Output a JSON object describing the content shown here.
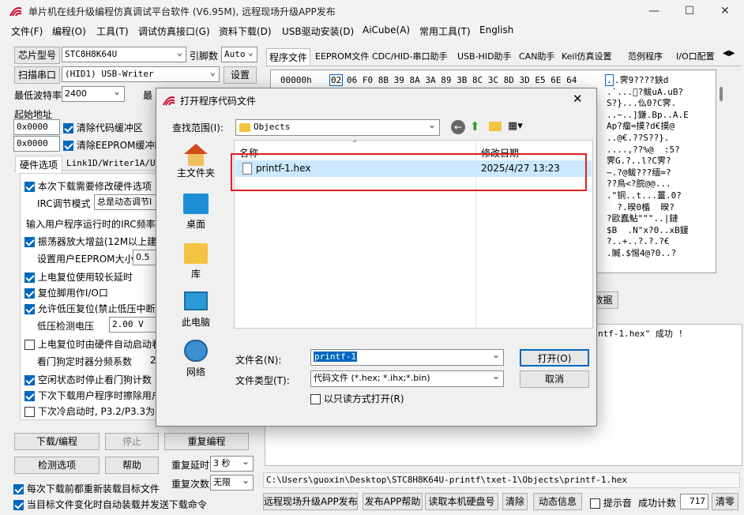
{
  "window": {
    "title": "单片机在线升级编程仿真调试平台软件 (V6.95M), 远程现场升级APP发布"
  },
  "menu": [
    "文件(F)",
    "编程(O)",
    "工具(T)",
    "调试仿真接口(G)",
    "资料下载(D)",
    "USB驱动安装(D)",
    "AiCube(A)",
    "常用工具(T)",
    "English"
  ],
  "left": {
    "chip_label": "芯片型号",
    "chip_value": "STC8H8K64U",
    "pin_label": "引脚数",
    "pin_value": "Auto",
    "scan_button": "扫描串口",
    "port_value": "(HID1) USB-Writer",
    "settings_button": "设置",
    "min_baud_label": "最低波特率",
    "min_baud_value": "2400",
    "max_baud_label": "最",
    "start_addr_label": "起始地址",
    "addr1": "0x0000",
    "clear_code": "清除代码缓冲区",
    "addr2": "0x0000",
    "clear_eeprom": "清除EEPROM缓冲区",
    "tab1": "硬件选项",
    "tab2": "Link1D/Writer1A/U8W",
    "opt_change": "本次下载需要修改硬件选项",
    "irc_mode_label": "IRC调节模式",
    "irc_mode_value": "总是动态调节I",
    "irc_freq_label": "输入用户程序运行时的IRC频率",
    "osc_gain": "振荡器放大增益(12M以上建议",
    "eeprom_label": "设置用户EEPROM大小",
    "eeprom_value": "0.5",
    "power_delay": "上电复位使用较长延时",
    "reset_io": "复位脚用作I/O口",
    "lvd_reset": "允许低压复位(禁止低压中断",
    "lvd_label": "低压检测电压",
    "lvd_value": "2.00 V",
    "wdt_auto": "上电复位时由硬件自动启动看",
    "wdt_div_label": "看门狗定时器分频系数",
    "wdt_div_value": "2",
    "idle_wdt": "空闲状态时停止看门狗计数",
    "erase_user": "下次下载用户程序时擦除用户",
    "cold_boot": "下次冷启动时, P3.2/P3.3为0",
    "download_button": "下载/编程",
    "stop_button": "停止",
    "repeat_button": "重复编程",
    "detect_button": "检测选项",
    "help_button": "帮助",
    "repeat_delay_label": "重复延时",
    "repeat_delay_value": "3 秒",
    "repeat_count_label": "重复次数",
    "repeat_count_value": "无限",
    "reload_each": "每次下载前都重新装载目标文件",
    "auto_reload": "当目标文件变化时自动装载并发送下载命令"
  },
  "right": {
    "tabs": [
      "程序文件",
      "EEPROM文件",
      "CDC/HID-串口助手",
      "USB-HID助手",
      "CAN助手",
      "Keil仿真设置",
      "范例程序",
      "I/O口配置"
    ],
    "hex_addr": "00000h",
    "hex_first": "02",
    "hex_rest": "06 F0 8B 39 8A 3A 89 3B 8C 3C 8D 3D E5 6E 64",
    "ascii_lines": [
      ".",
      ".霁9????鋏d",
      ".`...\u0000?鲅uA.uB?",
      "S?}...仫0?C霁.",
      "..~..]鎌.Bp..A.E",
      "Ap?瘤=摸?d€摸@",
      "..@€.??S??}.",
      "....,??%@  :5?",
      "霁G.?..l?C霁?",
      "~.?@鲅???缅=?",
      "??鳥<?脘@@...",
      ".\"铜..t...薑.0?",
      "  ?.暌0楯  暌?",
      "?歐蠢鮎\"\"\"..|鏈",
      "$B  .N\"x?0..xB鍰",
      "?..+..?.?.?€",
      ".贓.$惕4@?0..?"
    ],
    "side_btn": "数据",
    "log_text": "ntf-1.hex\" 成功 !",
    "path": "C:\\Users\\guoxin\\Desktop\\STC8H8K64U-printf\\txet-1\\Objects\\printf-1.hex",
    "btn_publish": "远程现场升级APP发布",
    "btn_help": "发布APP帮助",
    "btn_disk": "读取本机硬盘号",
    "btn_clear": "清除",
    "btn_anim": "动态信息",
    "chk_sound": "提示音",
    "count_label": "成功计数",
    "count_value": "717",
    "btn_clear2": "清零"
  },
  "dialog": {
    "title": "打开程序代码文件",
    "lookin_label": "查找范围(I):",
    "lookin_value": "Objects",
    "places": [
      "主文件夹",
      "桌面",
      "库",
      "此电脑",
      "网络"
    ],
    "col_name": "名称",
    "col_date": "修改日期",
    "file_name": "printf-1.hex",
    "file_date": "2025/4/27 13:23",
    "filename_label": "文件名(N):",
    "filename_value": "printf-1",
    "filetype_label": "文件类型(T):",
    "filetype_value": "代码文件 (*.hex; *.ihx;*.bin)",
    "readonly_label": "以只读方式打开(R)",
    "open_button": "打开(O)",
    "cancel_button": "取消"
  },
  "colors": {
    "accent": "#0067c0",
    "highlight": "#cce8ff",
    "redbox": "#e02020"
  }
}
